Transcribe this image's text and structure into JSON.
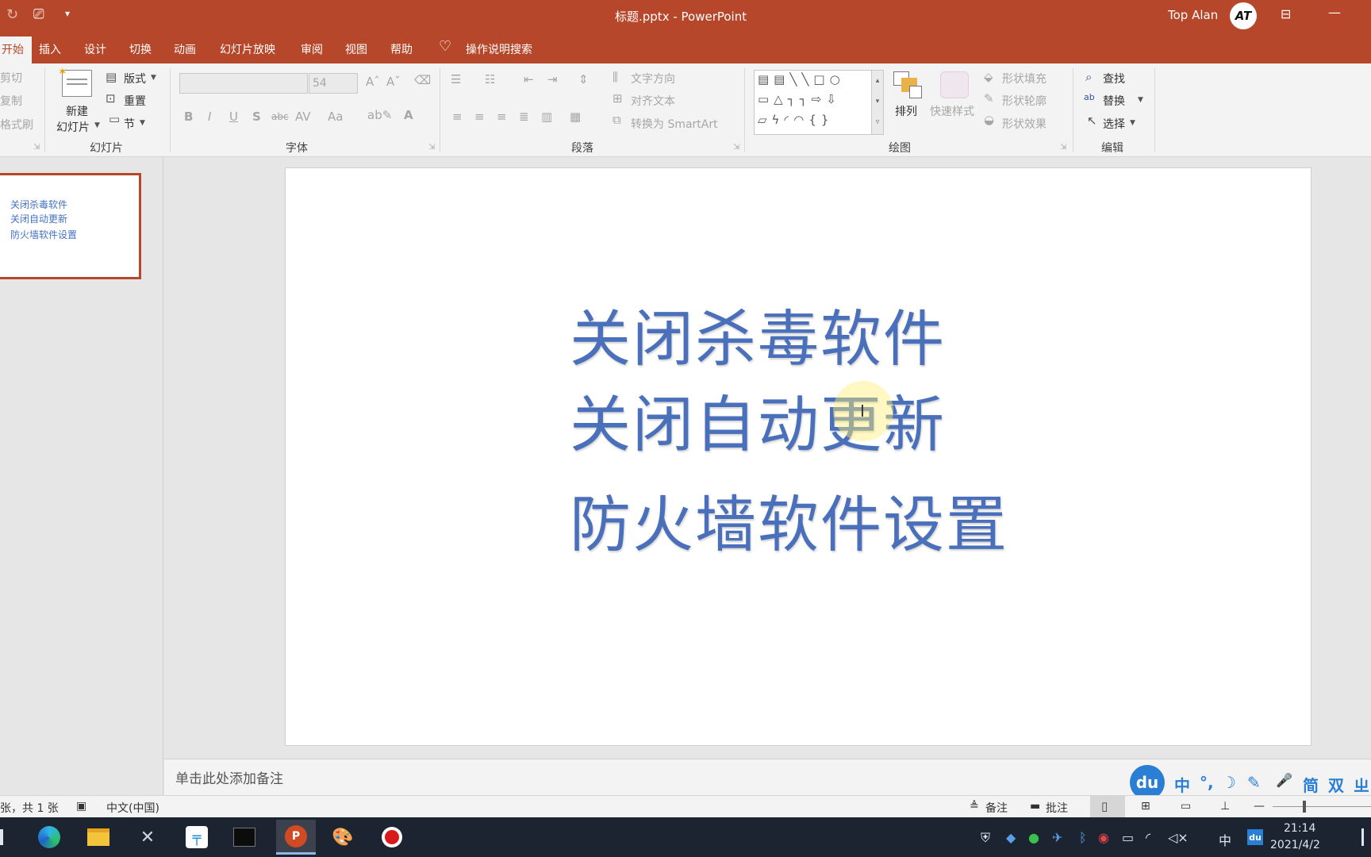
{
  "window": {
    "title": "标题.pptx  -  PowerPoint",
    "user_name": "Top Alan",
    "avatar_initials": "AT"
  },
  "tabs": [
    "开始",
    "插入",
    "设计",
    "切换",
    "动画",
    "幻灯片放映",
    "审阅",
    "视图",
    "帮助"
  ],
  "tell_me": "操作说明搜索",
  "ribbon": {
    "clipboard": {
      "cut": "剪切",
      "copy": "复制",
      "format_painter": "格式刷"
    },
    "slides": {
      "new_slide_line1": "新建",
      "new_slide_line2": "幻灯片",
      "layout": "版式",
      "reset": "重置",
      "section": "节",
      "group_label": "幻灯片"
    },
    "font": {
      "font_name": "",
      "font_size": "54",
      "group_label": "字体",
      "bold": "B",
      "italic": "I",
      "underline": "U",
      "shadow": "S",
      "strike": "abc",
      "spacing": "AV",
      "case": "Aa",
      "color": "A"
    },
    "paragraph": {
      "text_direction": "文字方向",
      "align_text": "对齐文本",
      "convert_smartart": "转换为 SmartArt",
      "group_label": "段落"
    },
    "drawing": {
      "arrange": "排列",
      "quick_styles": "快速样式",
      "shape_fill": "形状填充",
      "shape_outline": "形状轮廓",
      "shape_effects": "形状效果",
      "group_label": "绘图"
    },
    "editing": {
      "find": "查找",
      "replace": "替换",
      "select": "选择",
      "group_label": "编辑"
    }
  },
  "thumbnail": {
    "lines": [
      "关闭杀毒软件",
      "关闭自动更新",
      "防火墙软件设置"
    ]
  },
  "slide": {
    "lines": [
      "关闭杀毒软件",
      "关闭自动更新",
      "防火墙软件设置"
    ],
    "text_color": "#4a6fbb"
  },
  "notes": {
    "placeholder": "单击此处添加备注"
  },
  "status": {
    "slide_count": "张，共 1 张",
    "language": "中文(中国)",
    "notes_btn": "备注",
    "comments_btn": "批注"
  },
  "ime": {
    "chars": [
      "中",
      "°,",
      "☽",
      "✎",
      "🎤",
      "简",
      "双",
      "ㄓ"
    ]
  },
  "taskbar": {
    "clock_time": "21:14",
    "clock_date": "2021/4/2",
    "ime_mode": "中"
  },
  "colors": {
    "accent": "#b7472a",
    "taskbar": "#1b2430"
  }
}
